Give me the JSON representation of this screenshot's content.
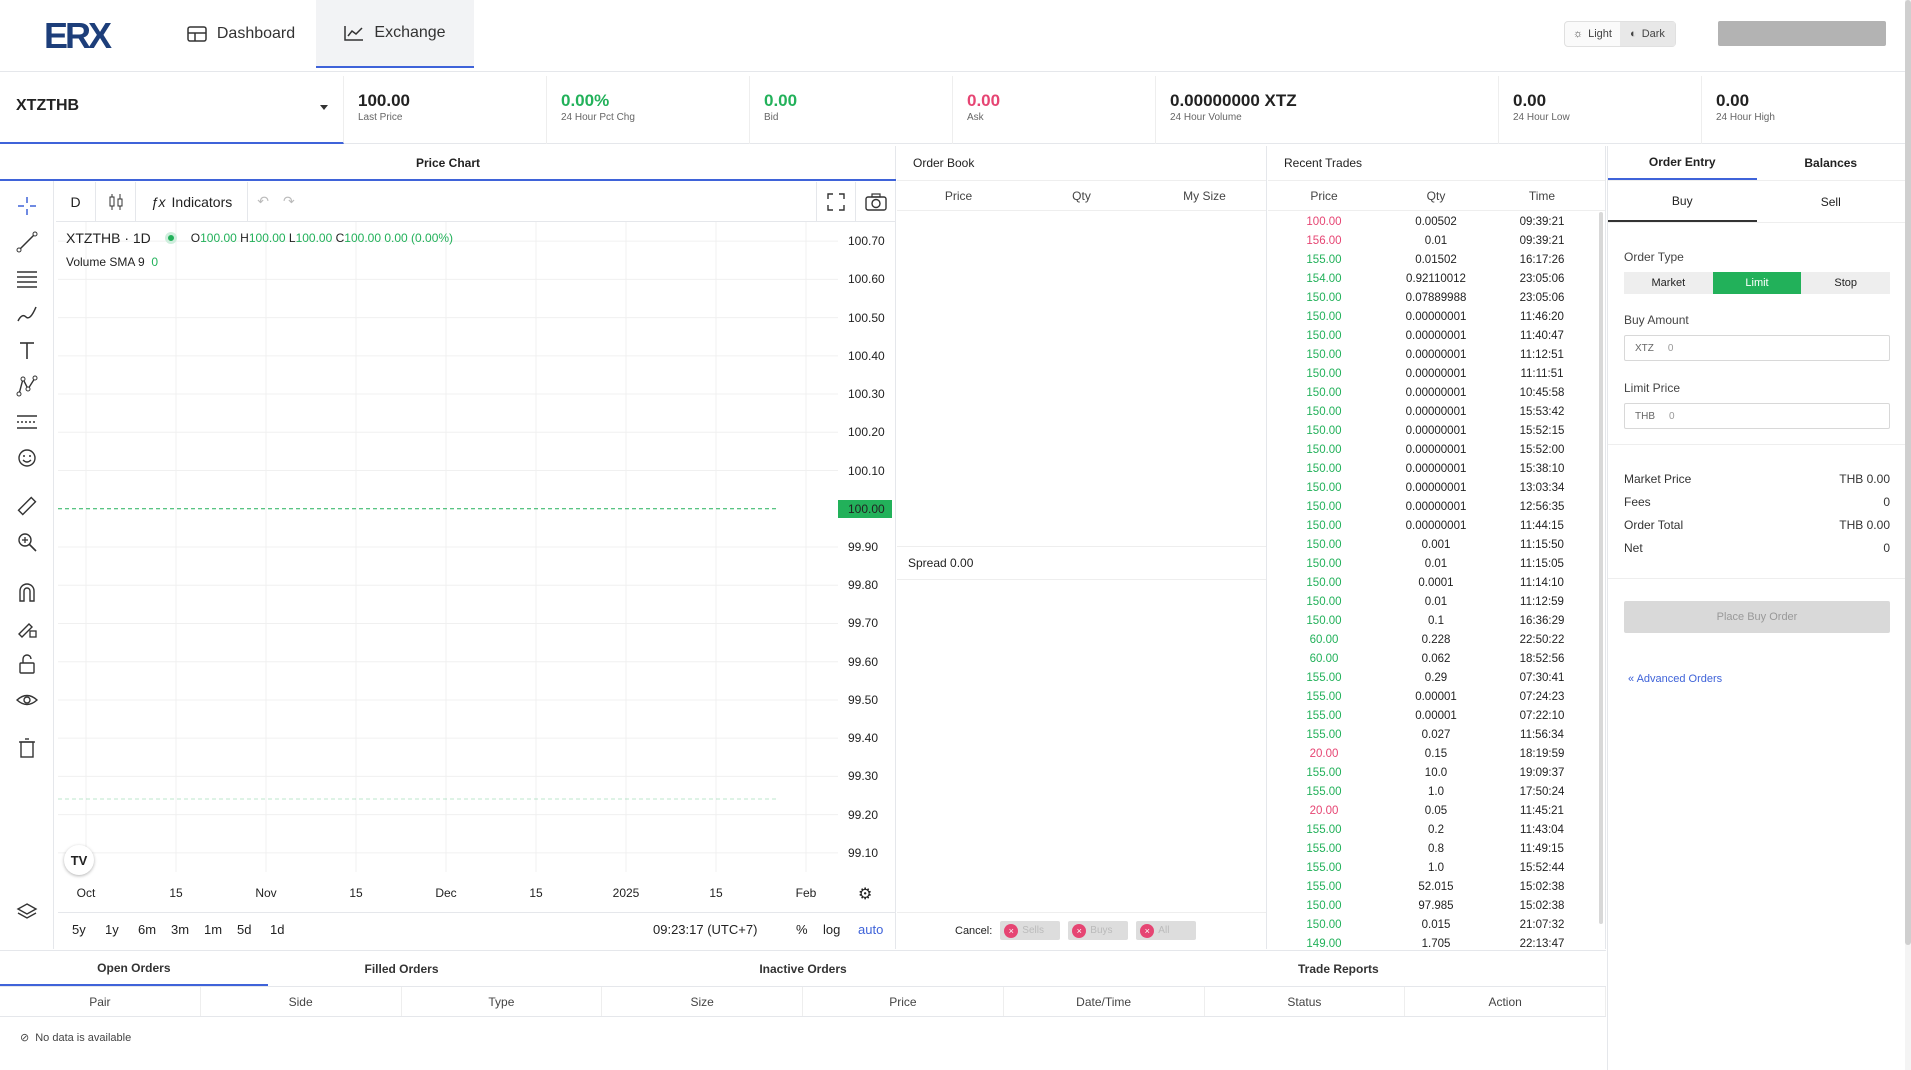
{
  "header": {
    "logo_text": "ERX",
    "nav": [
      {
        "label": "Dashboard"
      },
      {
        "label": "Exchange"
      }
    ],
    "theme": {
      "light": "Light",
      "dark": "Dark"
    }
  },
  "ticker": {
    "pair": "XTZTHB",
    "stats": [
      {
        "value": "100.00",
        "label": "Last Price",
        "tone": "normal"
      },
      {
        "value": "0.00%",
        "label": "24 Hour Pct Chg",
        "tone": "green"
      },
      {
        "value": "0.00",
        "label": "Bid",
        "tone": "green"
      },
      {
        "value": "0.00",
        "label": "Ask",
        "tone": "red"
      },
      {
        "value": "0.00000000 XTZ",
        "label": "24 Hour Volume",
        "tone": "normal"
      },
      {
        "value": "0.00",
        "label": "24 Hour Low",
        "tone": "normal"
      },
      {
        "value": "0.00",
        "label": "24 Hour High",
        "tone": "normal"
      }
    ]
  },
  "chart": {
    "title": "Price Chart",
    "interval_button": "D",
    "indicators_label": "Indicators",
    "symbol_label": "XTZTHB · 1D",
    "ohlc": {
      "o_label": "O",
      "o": "100.00",
      "h_label": "H",
      "h": "100.00",
      "l_label": "L",
      "l": "100.00",
      "c_label": "C",
      "c": "100.00",
      "change": "0.00 (0.00%)"
    },
    "volume_label": "Volume SMA 9",
    "volume_value": "0",
    "y_ticks": [
      "100.70",
      "100.60",
      "100.50",
      "100.40",
      "100.30",
      "100.20",
      "100.10",
      "99.90",
      "99.80",
      "99.70",
      "99.60",
      "99.50",
      "99.40",
      "99.30",
      "99.20",
      "99.10"
    ],
    "current_price": "100.00",
    "x_ticks": [
      "Oct",
      "15",
      "Nov",
      "15",
      "Dec",
      "15",
      "2025",
      "15",
      "Feb"
    ],
    "ranges": [
      "5y",
      "1y",
      "6m",
      "3m",
      "1m",
      "5d",
      "1d"
    ],
    "clock": "09:23:17 (UTC+7)",
    "scale_options": {
      "percent": "%",
      "log": "log",
      "auto": "auto"
    },
    "accent": "#3f63d9"
  },
  "chart_data": {
    "type": "line",
    "x": [],
    "values": [],
    "title": "",
    "xlabel": "",
    "ylabel": "",
    "ylim": [
      99.05,
      100.75
    ],
    "current_value": 100.0
  },
  "orderbook": {
    "title": "Order Book",
    "columns": [
      "Price",
      "Qty",
      "My Size"
    ],
    "spread_label": "Spread 0.00",
    "cancel_label": "Cancel:",
    "cancel_buttons": [
      "Sells",
      "Buys",
      "All"
    ]
  },
  "recent_trades": {
    "title": "Recent Trades",
    "columns": [
      "Price",
      "Qty",
      "Time"
    ],
    "rows": [
      {
        "price": "100.00",
        "qty": "0.00502",
        "time": "09:39:21",
        "side": "red"
      },
      {
        "price": "156.00",
        "qty": "0.01",
        "time": "09:39:21",
        "side": "red"
      },
      {
        "price": "155.00",
        "qty": "0.01502",
        "time": "16:17:26",
        "side": "green"
      },
      {
        "price": "154.00",
        "qty": "0.92110012",
        "time": "23:05:06",
        "side": "green"
      },
      {
        "price": "150.00",
        "qty": "0.07889988",
        "time": "23:05:06",
        "side": "green"
      },
      {
        "price": "150.00",
        "qty": "0.00000001",
        "time": "11:46:20",
        "side": "green"
      },
      {
        "price": "150.00",
        "qty": "0.00000001",
        "time": "11:40:47",
        "side": "green"
      },
      {
        "price": "150.00",
        "qty": "0.00000001",
        "time": "11:12:51",
        "side": "green"
      },
      {
        "price": "150.00",
        "qty": "0.00000001",
        "time": "11:11:51",
        "side": "green"
      },
      {
        "price": "150.00",
        "qty": "0.00000001",
        "time": "10:45:58",
        "side": "green"
      },
      {
        "price": "150.00",
        "qty": "0.00000001",
        "time": "15:53:42",
        "side": "green"
      },
      {
        "price": "150.00",
        "qty": "0.00000001",
        "time": "15:52:15",
        "side": "green"
      },
      {
        "price": "150.00",
        "qty": "0.00000001",
        "time": "15:52:00",
        "side": "green"
      },
      {
        "price": "150.00",
        "qty": "0.00000001",
        "time": "15:38:10",
        "side": "green"
      },
      {
        "price": "150.00",
        "qty": "0.00000001",
        "time": "13:03:34",
        "side": "green"
      },
      {
        "price": "150.00",
        "qty": "0.00000001",
        "time": "12:56:35",
        "side": "green"
      },
      {
        "price": "150.00",
        "qty": "0.00000001",
        "time": "11:44:15",
        "side": "green"
      },
      {
        "price": "150.00",
        "qty": "0.001",
        "time": "11:15:50",
        "side": "green"
      },
      {
        "price": "150.00",
        "qty": "0.01",
        "time": "11:15:05",
        "side": "green"
      },
      {
        "price": "150.00",
        "qty": "0.0001",
        "time": "11:14:10",
        "side": "green"
      },
      {
        "price": "150.00",
        "qty": "0.01",
        "time": "11:12:59",
        "side": "green"
      },
      {
        "price": "150.00",
        "qty": "0.1",
        "time": "16:36:29",
        "side": "green"
      },
      {
        "price": "60.00",
        "qty": "0.228",
        "time": "22:50:22",
        "side": "green"
      },
      {
        "price": "60.00",
        "qty": "0.062",
        "time": "18:52:56",
        "side": "green"
      },
      {
        "price": "155.00",
        "qty": "0.29",
        "time": "07:30:41",
        "side": "green"
      },
      {
        "price": "155.00",
        "qty": "0.00001",
        "time": "07:24:23",
        "side": "green"
      },
      {
        "price": "155.00",
        "qty": "0.00001",
        "time": "07:22:10",
        "side": "green"
      },
      {
        "price": "155.00",
        "qty": "0.027",
        "time": "11:56:34",
        "side": "green"
      },
      {
        "price": "20.00",
        "qty": "0.15",
        "time": "18:19:59",
        "side": "red"
      },
      {
        "price": "155.00",
        "qty": "10.0",
        "time": "19:09:37",
        "side": "green"
      },
      {
        "price": "155.00",
        "qty": "1.0",
        "time": "17:50:24",
        "side": "green"
      },
      {
        "price": "20.00",
        "qty": "0.05",
        "time": "11:45:21",
        "side": "red"
      },
      {
        "price": "155.00",
        "qty": "0.2",
        "time": "11:43:04",
        "side": "green"
      },
      {
        "price": "155.00",
        "qty": "0.8",
        "time": "11:49:15",
        "side": "green"
      },
      {
        "price": "155.00",
        "qty": "1.0",
        "time": "15:52:44",
        "side": "green"
      },
      {
        "price": "155.00",
        "qty": "52.015",
        "time": "15:02:38",
        "side": "green"
      },
      {
        "price": "150.00",
        "qty": "97.985",
        "time": "15:02:38",
        "side": "green"
      },
      {
        "price": "150.00",
        "qty": "0.015",
        "time": "21:07:32",
        "side": "green"
      },
      {
        "price": "149.00",
        "qty": "1.705",
        "time": "22:13:47",
        "side": "green"
      }
    ]
  },
  "order_entry": {
    "tabs": [
      "Order Entry",
      "Balances"
    ],
    "sides": [
      "Buy",
      "Sell"
    ],
    "order_type_label": "Order Type",
    "order_types": [
      "Market",
      "Limit",
      "Stop"
    ],
    "buy_amount_label": "Buy Amount",
    "buy_amount_unit": "XTZ",
    "buy_amount_placeholder": "0",
    "limit_price_label": "Limit Price",
    "limit_price_unit": "THB",
    "limit_price_placeholder": "0",
    "summary": [
      {
        "label": "Market Price",
        "value": "THB 0.00"
      },
      {
        "label": "Fees",
        "value": "0"
      },
      {
        "label": "Order Total",
        "value": "THB 0.00"
      },
      {
        "label": "Net",
        "value": "0"
      }
    ],
    "place_order": "Place Buy Order",
    "advanced": "« Advanced Orders"
  },
  "bottom": {
    "tabs": [
      "Open Orders",
      "Filled Orders",
      "Inactive Orders",
      "Trade Reports"
    ],
    "columns": [
      "Pair",
      "Side",
      "Type",
      "Size",
      "Price",
      "Date/Time",
      "Status",
      "Action"
    ],
    "empty": "No data is available"
  },
  "colors": {
    "green": "#22b15a",
    "red": "#e64573",
    "accent": "#3f63d9"
  }
}
